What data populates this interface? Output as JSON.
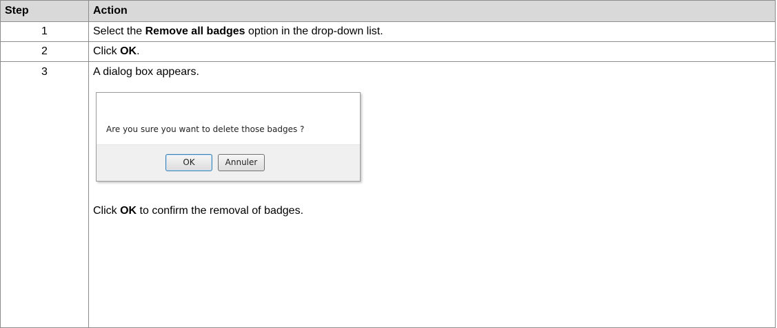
{
  "header": {
    "step": "Step",
    "action": "Action"
  },
  "rows": [
    {
      "num": "1",
      "pre": "Select the ",
      "bold": "Remove all badges",
      "post": " option in the drop-down list."
    },
    {
      "num": "2",
      "pre": "Click ",
      "bold": "OK",
      "post": "."
    },
    {
      "num": "3",
      "text": "A dialog box appears.",
      "confirm_pre": "Click ",
      "confirm_bold": "OK",
      "confirm_post": " to confirm the removal of badges."
    }
  ],
  "dialog": {
    "message": "Are you sure you want to delete those badges ?",
    "ok_label": "OK",
    "cancel_label": "Annuler"
  }
}
